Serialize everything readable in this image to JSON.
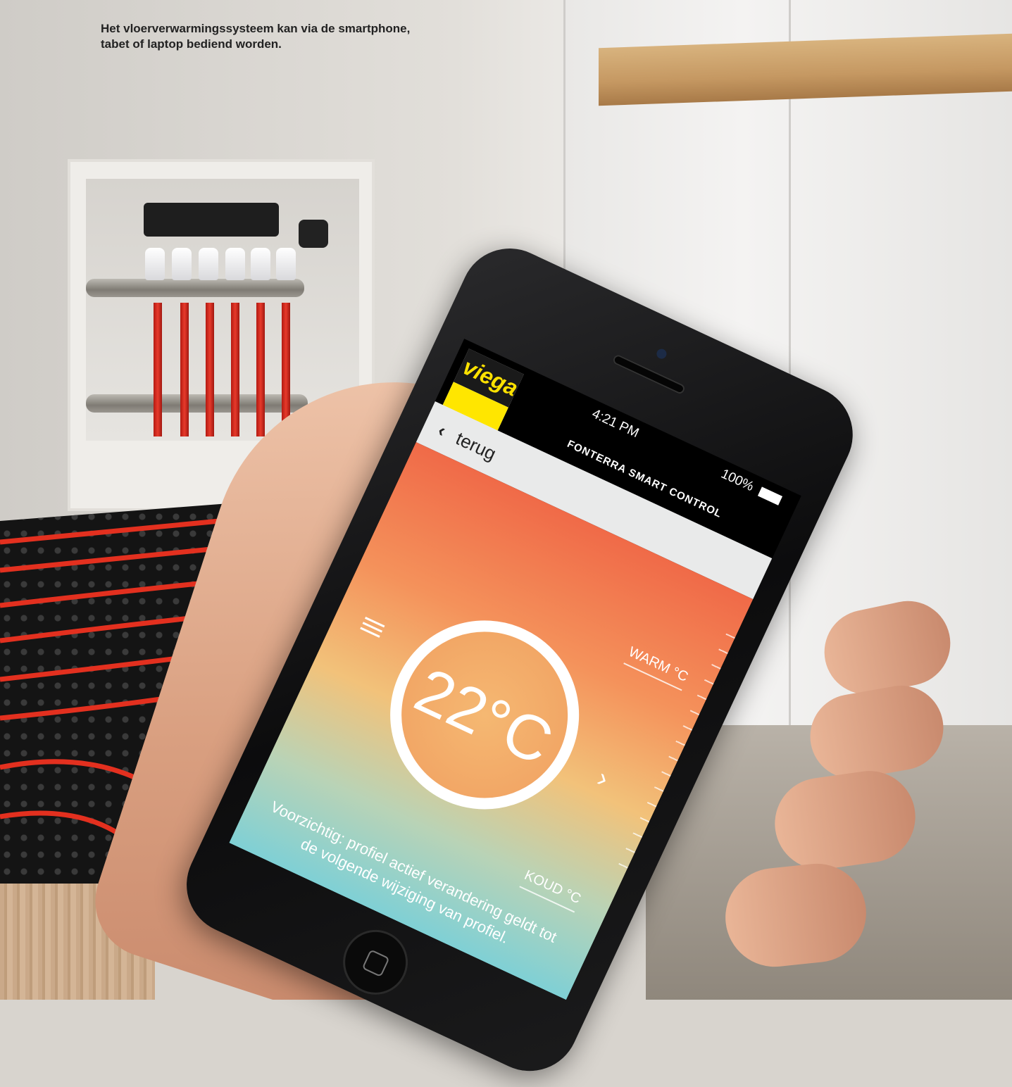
{
  "caption": {
    "line1": "Het vloerverwarmingssysteem kan via de smartphone,",
    "line2": "tabet of laptop bediend worden."
  },
  "phone": {
    "status": {
      "signal": "●●●○○",
      "time": "4:21 PM",
      "battery": "100%"
    },
    "app": {
      "logo_text": "viega",
      "title": "FONTERRA SMART CONTROL",
      "back_label": "terug",
      "temperature": "22°C",
      "warm_label": "WARM °C",
      "cold_label": "KOUD °C",
      "notice": "Voorzichtig: profiel actief verandering geldt tot de volgende wijziging van profiel."
    }
  },
  "colors": {
    "brand_yellow": "#ffe600",
    "gradient_top": "#f06a48",
    "gradient_bottom": "#7fd0d5"
  },
  "icons": {
    "menu": "hamburger-icon",
    "back": "chevron-left-icon",
    "next": "chevron-right-icon",
    "wifi": "wifi-icon",
    "home": "home-button-icon"
  }
}
